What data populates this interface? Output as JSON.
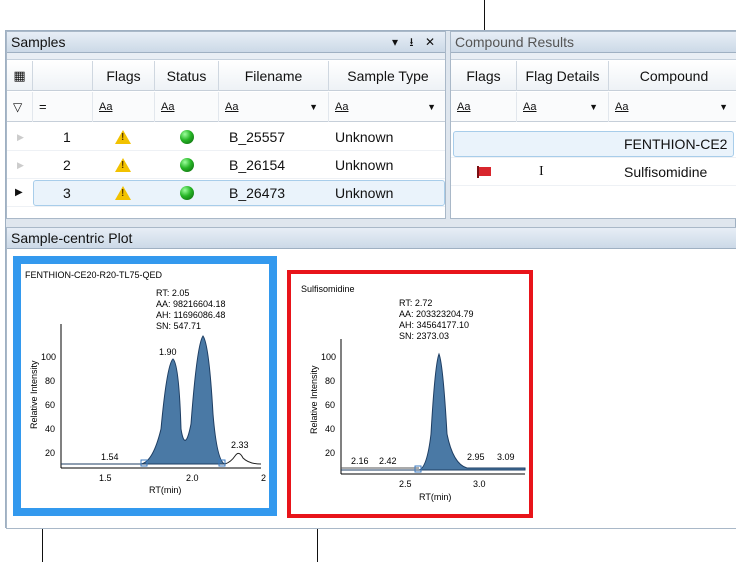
{
  "samples_pane": {
    "title": "Samples",
    "controls": "▾ ⭳ ✕",
    "headers": [
      "Flags",
      "Status",
      "Filename",
      "Sample Type"
    ],
    "filter_text": "Aa",
    "rows": [
      {
        "num": "1",
        "filename": "B_25557",
        "sample_type": "Unknown"
      },
      {
        "num": "2",
        "filename": "B_26154",
        "sample_type": "Unknown"
      },
      {
        "num": "3",
        "filename": "B_26473",
        "sample_type": "Unknown"
      }
    ]
  },
  "compound_pane": {
    "title": "Compound Results",
    "headers": [
      "Flags",
      "Flag Details",
      "Compound"
    ],
    "filter_text": "Aa",
    "rows": [
      {
        "flag_detail": "",
        "compound": "FENTHION-CE2"
      },
      {
        "flag_detail": "I",
        "compound": "Sulfisomidine"
      }
    ]
  },
  "plot_pane": {
    "title": "Sample-centric Plot",
    "plots": [
      {
        "name": "FENTHION-CE20-R20-TL75-QED",
        "stats": [
          "RT: 2.05",
          "AA: 98216604.18",
          "AH: 11696086.48",
          "SN: 547.71"
        ],
        "peak_labels": [
          "1.90",
          "1.54",
          "2.33"
        ],
        "y_ticks": [
          "100",
          "80",
          "60",
          "40",
          "20"
        ],
        "x_ticks": [
          "1.5",
          "2.0",
          "2"
        ],
        "y_axis_label": "Relative Intensity",
        "x_axis_label": "RT(min)",
        "frame_color": "#3399ee"
      },
      {
        "name": "Sulfisomidine",
        "stats": [
          "RT: 2.72",
          "AA: 203323204.79",
          "AH: 34564177.10",
          "SN: 2373.03"
        ],
        "peak_labels": [
          "2.16",
          "2.42",
          "2.95",
          "3.09"
        ],
        "y_ticks": [
          "100",
          "80",
          "60",
          "40",
          "20"
        ],
        "x_ticks": [
          "2.5",
          "3.0"
        ],
        "y_axis_label": "Relative Intensity",
        "x_axis_label": "RT(min)",
        "frame_color": "#e8141a"
      }
    ]
  },
  "colors": {
    "flag_red": "#d8262d",
    "warn": "#f2c200",
    "status_ok": "#26b526",
    "selection": "#eaf3fb"
  }
}
